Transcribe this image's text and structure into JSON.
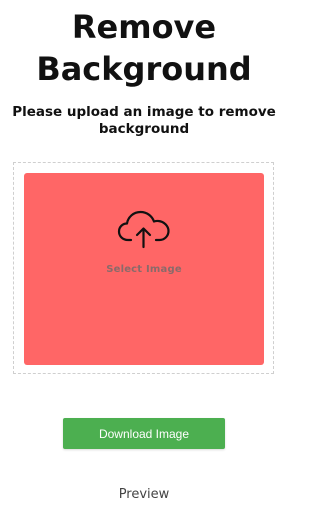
{
  "header": {
    "title_line1": "Remove",
    "title_line2": "Background",
    "subtitle_line1": "Please upload an image to remove",
    "subtitle_line2": "background"
  },
  "upload": {
    "icon": "cloud-upload-icon",
    "label": "Select Image",
    "background_color": "#ff6666"
  },
  "actions": {
    "download_label": "Download Image",
    "download_color": "#4caf50"
  },
  "footer": {
    "preview_label": "Preview"
  }
}
